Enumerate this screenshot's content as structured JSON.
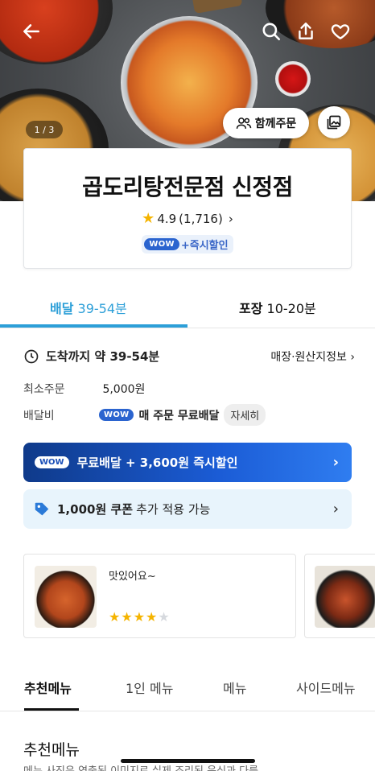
{
  "hero": {
    "photo_counter": "1 / 3",
    "together_order_label": "함께주문",
    "icons": [
      "back-arrow-icon",
      "search-icon",
      "share-icon",
      "heart-icon",
      "people-icon",
      "gallery-icon"
    ]
  },
  "store": {
    "name": "곱도리탕전문점 신정점",
    "rating": "4.9",
    "review_count": "(1,716)",
    "wow_badge": "WOW",
    "wow_text": "+즉시할인"
  },
  "delivery_tabs": [
    {
      "label": "배달",
      "time": "39-54분",
      "active": true
    },
    {
      "label": "포장",
      "time": "10-20분",
      "active": false
    }
  ],
  "info": {
    "arrival_label": "도착까지 약 39-54분",
    "store_info_link": "매장·원산지정보",
    "min_order_label": "최소주문",
    "min_order_value": "5,000원",
    "delivery_fee_label": "배달비",
    "delivery_fee_wow": "WOW",
    "delivery_fee_text": "매 주문 무료배달",
    "detail_button": "자세히"
  },
  "banner": {
    "wow": "WOW",
    "text": "무료배달 + 3,600원 즉시할인"
  },
  "coupon": {
    "amount": "1,000원 쿠폰",
    "text": "추가 적용 가능"
  },
  "reviews": [
    {
      "text": "맛있어요~",
      "rating": 4,
      "max_rating": 5
    },
    {
      "text": "",
      "rating": null
    }
  ],
  "menu_tabs": [
    "추천메뉴",
    "1인 메뉴",
    "메뉴",
    "사이드메뉴"
  ],
  "section": {
    "title": "추천메뉴",
    "desc": "메뉴 사진은 연출된 이미지로 실제 조리된 음식과 다를"
  },
  "colors": {
    "accent": "#2c9fd8",
    "wow_blue": "#2b64cf",
    "star": "#f5b400",
    "coupon_bg": "#e8f4fc"
  }
}
